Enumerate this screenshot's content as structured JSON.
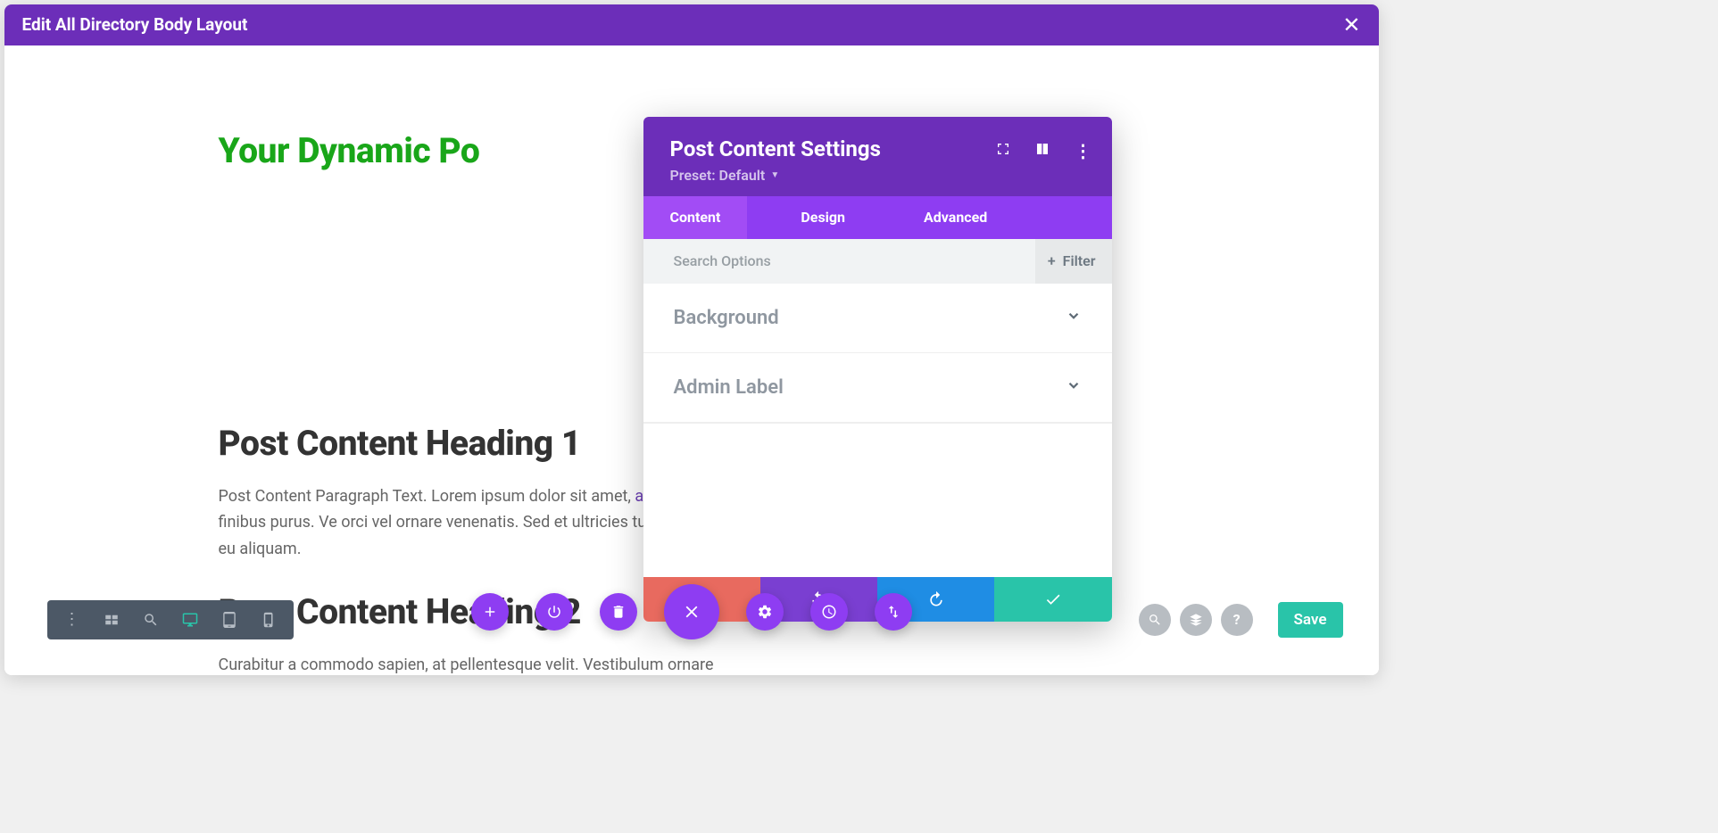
{
  "top_bar": {
    "title": "Edit All Directory Body Layout"
  },
  "page": {
    "dynamic_title": "Your Dynamic Po",
    "heading1": "Post Content Heading 1",
    "paragraph1_pre": "Post Content Paragraph Text. Lorem ipsum dolor sit amet, ",
    "paragraph1_link": "adipiscing elit",
    "paragraph1_post": ". Ut vitae congue libero, nec finibus purus. Ve orci vel ornare venenatis. Sed et ultricies turpis. Donec sit . Phasellus volutpat vitae mi eu aliquam.",
    "heading2": "Post Content Heading 2",
    "paragraph2": "Curabitur a commodo sapien, at pellentesque velit. Vestibulum ornare"
  },
  "panel": {
    "title": "Post Content Settings",
    "preset": "Preset: Default",
    "tabs": {
      "content": "Content",
      "design": "Design",
      "advanced": "Advanced"
    },
    "search_placeholder": "Search Options",
    "filter_label": "Filter",
    "sections": {
      "background": "Background",
      "admin_label": "Admin Label"
    }
  },
  "bottom": {
    "save": "Save"
  }
}
